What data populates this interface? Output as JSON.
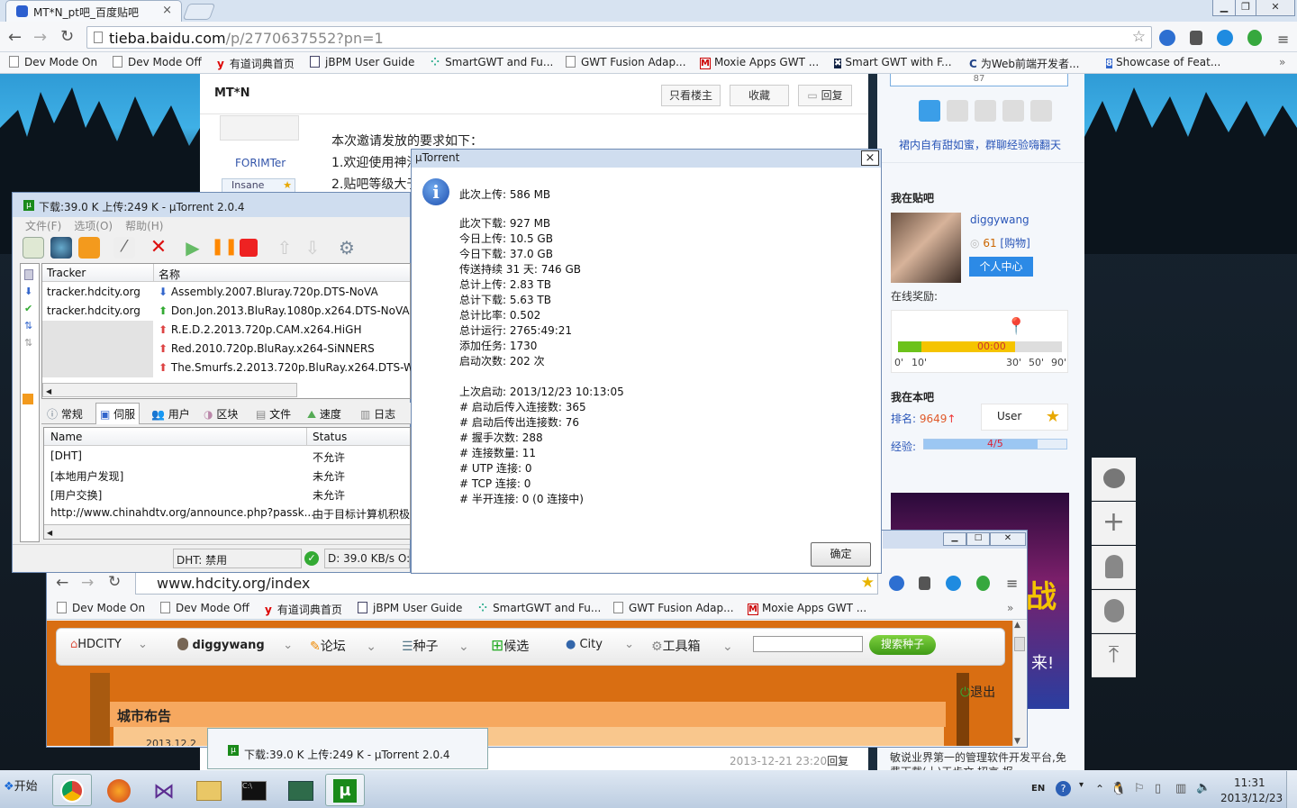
{
  "browser": {
    "tab_title": "MT*N_pt吧_百度贴吧",
    "tab_close": "×",
    "url_host": "tieba.baidu.com",
    "url_path": "/p/2770637552?pn=1",
    "bookmarks": [
      "Dev Mode On",
      "Dev Mode Off",
      "有道词典首页",
      "jBPM User Guide",
      "SmartGWT and Fu...",
      "GWT Fusion Adap...",
      "Moxie Apps GWT ...",
      "Smart GWT with F...",
      "为Web前端开发者...",
      "Showcase of Feat..."
    ],
    "bookmarks_more": "»"
  },
  "tieba": {
    "thread_title": "MT*N",
    "btn_only_op": "只看楼主",
    "btn_collect": "收藏",
    "btn_reply": "回复",
    "author_name": "FORIMTer",
    "author_level": "Insane",
    "post_line1": "本次邀请发放的要求如下：",
    "post_line2": "1.欢迎使用神池",
    "post_line3": "2.贴吧等级大于",
    "reply_time": "2013-12-21 23:20",
    "reply_label": "回复",
    "sidebar": {
      "sign_count": "87",
      "slogan": "裙内自有甜如蜜，群聊经验嗨翻天",
      "in_tieba_title": "我在贴吧",
      "username": "diggywang",
      "coins": "61",
      "buy": "[购物]",
      "personal_center": "个人中心",
      "online_reward": "在线奖励:",
      "timer": "00:00",
      "ticks": [
        "0'",
        "10'",
        "30'",
        "50'",
        "90'"
      ],
      "in_bar_title": "我在本吧",
      "rank_label": "排名:",
      "rank_value": "9649",
      "user_label": "User",
      "exp_label": "经验:",
      "exp_value": "4/5",
      "exp_fraction": 0.8,
      "ad_text_1": "战",
      "ad_text_2": "来!",
      "footer_text_1": "敏说业界第一的管理软件开发平台,免",
      "footer_text_2": "费下载(十)王步文 招京 报"
    }
  },
  "utorrent": {
    "title": "下载:39.0 K 上传:249 K - µTorrent 2.0.4",
    "menu": [
      "文件(F)",
      "选项(O)",
      "帮助(H)"
    ],
    "tracker_header": "Tracker",
    "name_header": "名称",
    "trackers": [
      "tracker.hdcity.org",
      "tracker.hdcity.org"
    ],
    "torrents": [
      "Assembly.2007.Bluray.720p.DTS-NoVA",
      "Don.Jon.2013.BluRay.1080p.x264.DTS-NoVA",
      "R.E.D.2.2013.720p.CAM.x264.HiGH",
      "Red.2010.720p.BluRay.x264-SiNNERS",
      "The.Smurfs.2.2013.720p.BluRay.x264.DTS-WiK"
    ],
    "tabs": [
      "常规",
      "伺服",
      "用户",
      "区块",
      "文件",
      "速度",
      "日志"
    ],
    "peers_headers": [
      "Name",
      "Status"
    ],
    "peers": [
      {
        "name": "[DHT]",
        "status": "不允许"
      },
      {
        "name": "[本地用户发现]",
        "status": "未允许"
      },
      {
        "name": "[用户交换]",
        "status": "未允许"
      },
      {
        "name": "http://www.chinahdtv.org/announce.php?passk...",
        "status": "由于目标计算机积极"
      }
    ],
    "status_dht": "DHT: 禁用",
    "status_speed": "D: 39.0 KB/s O:"
  },
  "dialog": {
    "title": "µTorrent",
    "lines": [
      "此次上传: 586 MB",
      "此次下载: 927 MB",
      "今日上传: 10.5 GB",
      "今日下载: 37.0 GB",
      "传送持续 31 天: 746 GB",
      "总计上传: 2.83 TB",
      "总计下载: 5.63 TB",
      "总计比率: 0.502",
      "总计运行: 2765:49:21",
      "添加任务: 1730",
      "启动次数: 202 次",
      "上次启动: 2013/12/23 10:13:05",
      "# 启动后传入连接数: 365",
      "# 启动后传出连接数: 76",
      "# 握手次数: 288",
      "# 连接数量: 11",
      "# UTP 连接: 0",
      "# TCP 连接: 0",
      "# 半开连接: 0 (0 连接中)"
    ],
    "ok": "确定",
    "close": "×"
  },
  "browser2": {
    "url": "www.hdcity.org/index",
    "bookmarks": [
      "Dev Mode On",
      "Dev Mode Off",
      "有道词典首页",
      "jBPM User Guide",
      "SmartGWT and Fu...",
      "GWT Fusion Adap...",
      "Moxie Apps GWT ..."
    ],
    "bookmarks_more": "»",
    "nav": [
      "HDCITY",
      "diggywang",
      "论坛",
      "种子",
      "候选",
      "City",
      "工具箱"
    ],
    "search_button": "搜索种子",
    "logout": "退出",
    "announce": "城市布告",
    "date_partial": "2013.12.2"
  },
  "taskbar": {
    "start": "开始",
    "preview_title": "下载:39.0 K 上传:249 K - µTorrent 2.0.4",
    "lang": "EN",
    "time": "11:31",
    "date": "2013/12/23"
  }
}
